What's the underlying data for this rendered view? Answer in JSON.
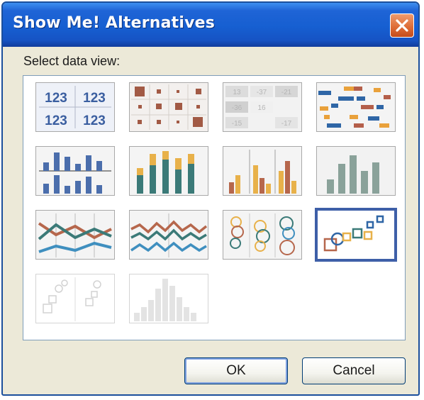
{
  "window": {
    "title": "Show Me! Alternatives"
  },
  "titlebar": {
    "close_icon": "close-x-icon"
  },
  "prompt": {
    "label": "Select data view:"
  },
  "colors": {
    "accent": "#3e5fa8",
    "blue_series": "#4b6eac",
    "orange_series": "#e8b14a",
    "brown_series": "#b6674c",
    "teal_series": "#3b7a78",
    "gray_series": "#8aa29a",
    "close_button": "#dd6a34"
  },
  "views": [
    {
      "icon": "text-table-icon",
      "cells": [
        "123",
        "123",
        "123",
        "123"
      ],
      "state": "enabled"
    },
    {
      "icon": "heat-map-icon",
      "state": "enabled"
    },
    {
      "icon": "highlight-table-icon",
      "cells": [
        "13",
        "-37",
        "-21",
        "-36",
        "16",
        "-15",
        "-17"
      ],
      "state": "enabled"
    },
    {
      "icon": "gantt-chart-icon",
      "state": "enabled"
    },
    {
      "icon": "side-by-side-bars-icon",
      "state": "enabled"
    },
    {
      "icon": "stacked-bars-icon",
      "state": "enabled"
    },
    {
      "icon": "side-by-side-columns-icon",
      "state": "enabled"
    },
    {
      "icon": "measure-bars-icon",
      "state": "enabled"
    },
    {
      "icon": "lines-discrete-icon",
      "state": "enabled"
    },
    {
      "icon": "lines-continuous-icon",
      "state": "enabled"
    },
    {
      "icon": "circle-views-icon",
      "state": "enabled"
    },
    {
      "icon": "scatter-plot-icon",
      "state": "selected"
    },
    {
      "icon": "scatter-matrix-icon",
      "state": "disabled"
    },
    {
      "icon": "histogram-icon",
      "state": "disabled"
    }
  ],
  "buttons": {
    "ok": "OK",
    "cancel": "Cancel"
  }
}
